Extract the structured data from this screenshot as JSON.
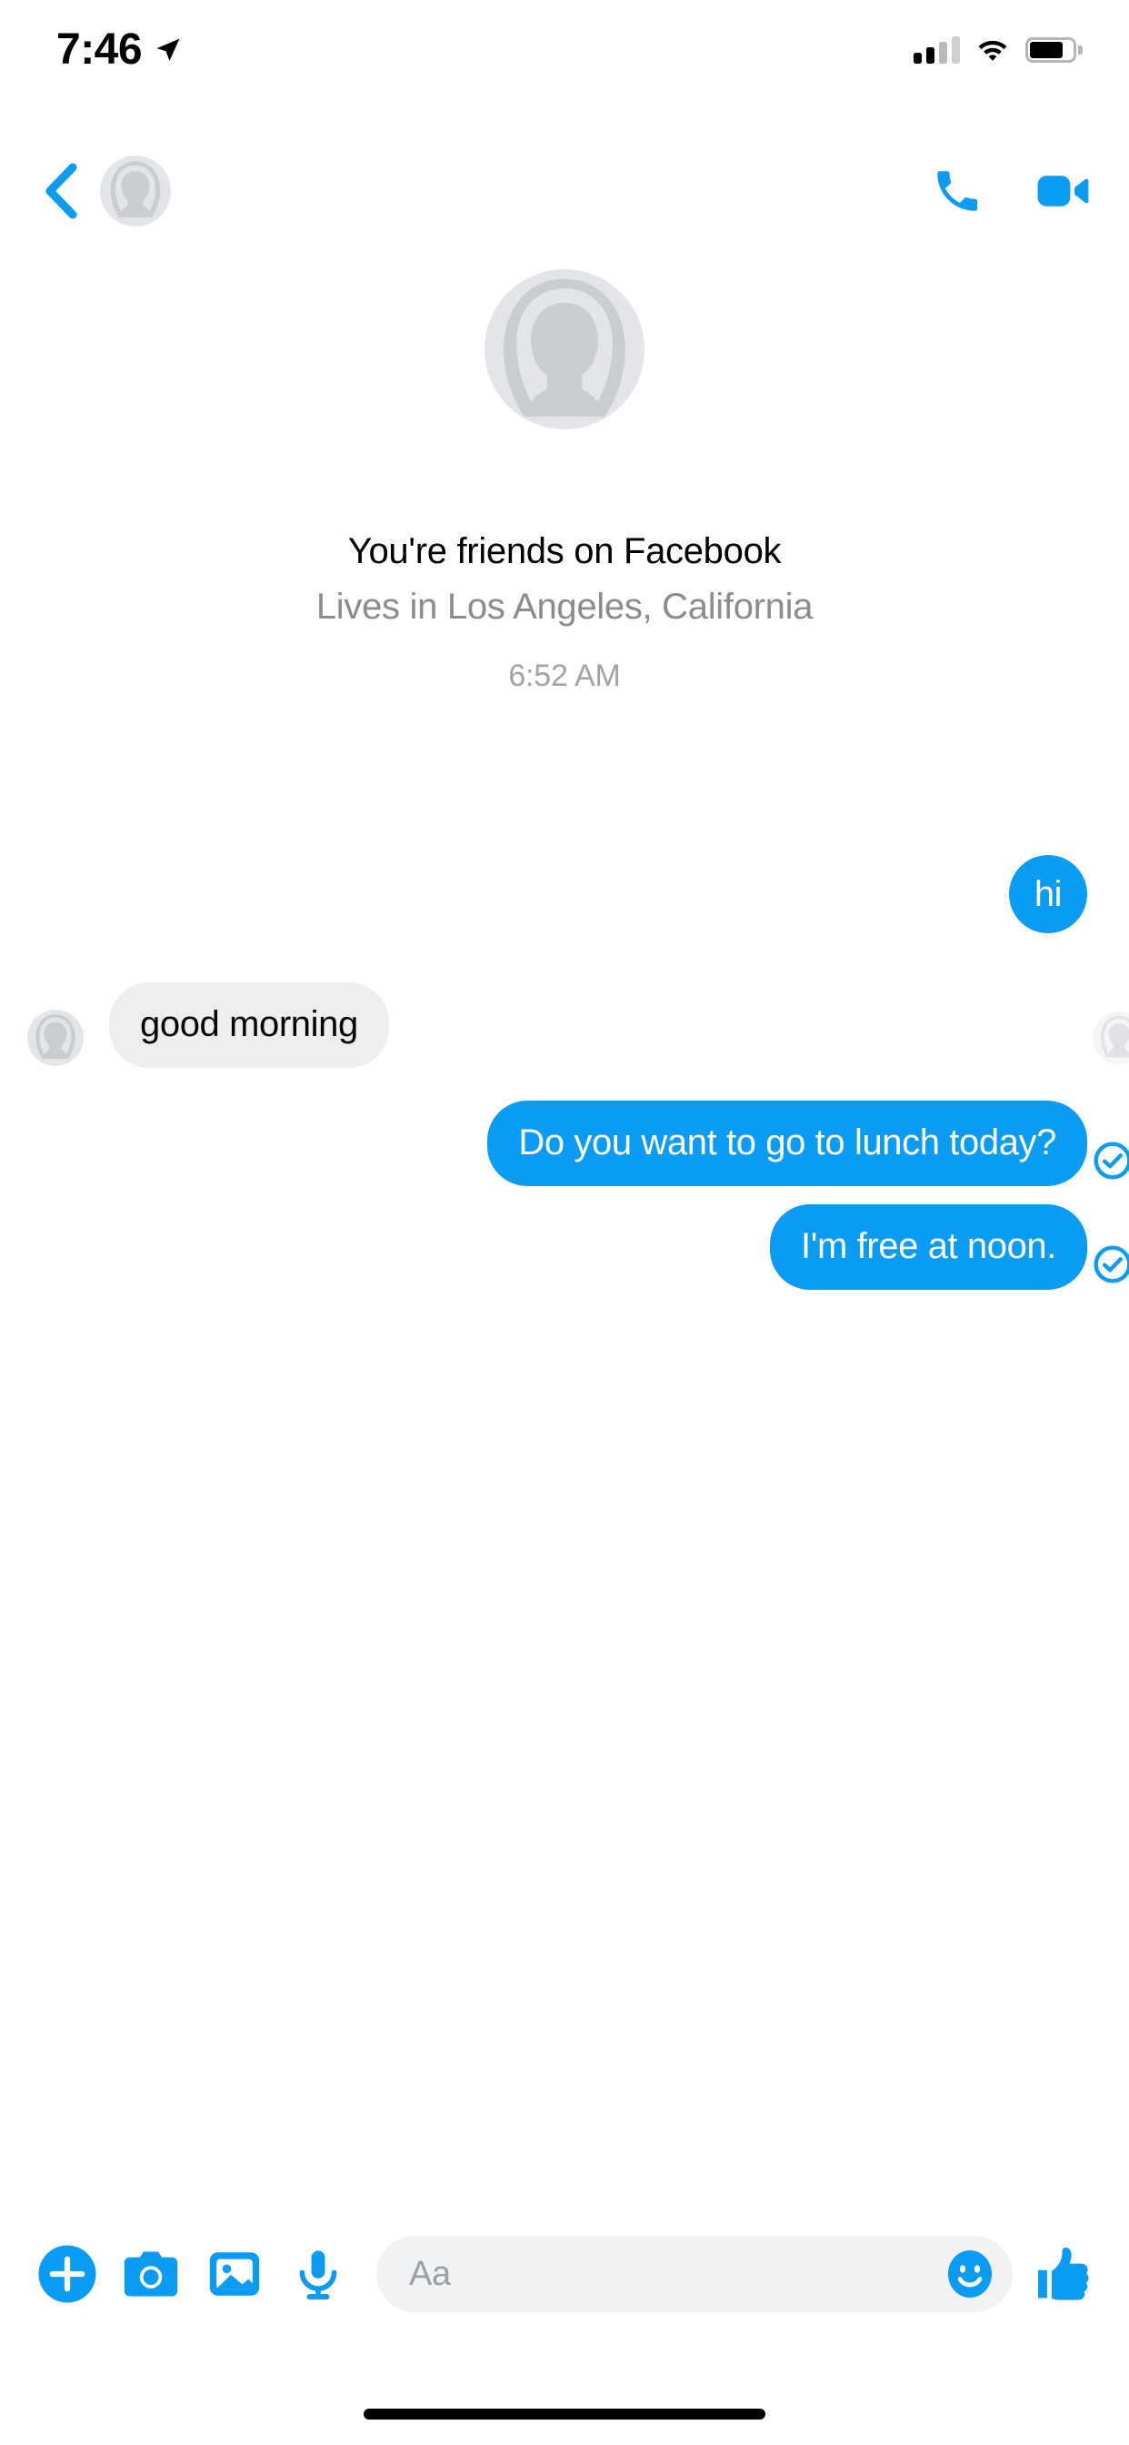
{
  "status_bar": {
    "time": "7:46",
    "location_icon": "location-arrow-icon",
    "signal_icon": "cellular-signal-icon",
    "signal_bars_filled": 2,
    "signal_bars_total": 4,
    "wifi_icon": "wifi-icon",
    "battery_icon": "battery-icon",
    "battery_percent": 75
  },
  "nav_bar": {
    "back_icon": "chevron-left-icon",
    "avatar_icon": "default-person-avatar-icon",
    "contact_name": "",
    "contact_name_redacted": true,
    "call_icon": "phone-icon",
    "video_icon": "video-camera-icon",
    "accent_color": "#0a9bf5"
  },
  "profile": {
    "avatar_icon": "default-person-avatar-icon",
    "name": "",
    "name_redacted": true,
    "friends_status": "You're friends on Facebook",
    "location": "Lives in Los Angeles, California",
    "timestamp": "6:52 AM"
  },
  "messages": [
    {
      "id": "m1",
      "text": "hi",
      "direction": "outgoing",
      "shape": "circle",
      "receipt": "none",
      "bubble_color": "#0a9bf5",
      "text_color": "#ffffff"
    },
    {
      "id": "m2",
      "text": "good morning",
      "direction": "incoming",
      "shape": "pill",
      "avatar_icon": "default-person-avatar-icon",
      "seen_avatar_icon": "seen-receipt-avatar-icon",
      "bubble_color": "#eceef0",
      "text_color": "#050505"
    },
    {
      "id": "m3",
      "text": "Do you want to go to lunch today?",
      "direction": "outgoing",
      "shape": "pill",
      "receipt": "delivered-check-icon",
      "bubble_color": "#0a9bf5",
      "text_color": "#ffffff"
    },
    {
      "id": "m4",
      "text": "I'm free at noon.",
      "direction": "outgoing",
      "shape": "pill",
      "receipt": "delivered-check-icon",
      "bubble_color": "#0a9bf5",
      "text_color": "#ffffff"
    }
  ],
  "composer": {
    "add_icon": "plus-circle-icon",
    "camera_icon": "camera-icon",
    "gallery_icon": "photo-gallery-icon",
    "mic_icon": "microphone-icon",
    "input_value": "",
    "input_placeholder": "Aa",
    "emoji_icon": "smiley-face-icon",
    "like_icon": "thumbs-up-icon",
    "accent_color": "#0a9bf5",
    "input_background": "#f1f2f3"
  },
  "home_indicator": "home-indicator-bar"
}
